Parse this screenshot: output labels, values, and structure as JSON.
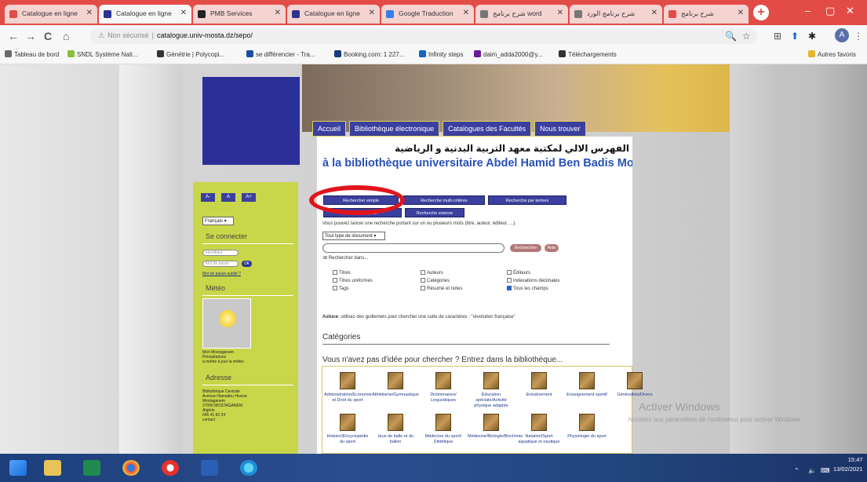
{
  "browser": {
    "tabs": [
      {
        "label": "Catalogue en ligne",
        "color": "#e34b47",
        "active": false
      },
      {
        "label": "Catalogue en ligne",
        "color": "#2d3190",
        "active": true
      },
      {
        "label": "PMB Services",
        "color": "#222222",
        "active": false
      },
      {
        "label": "Catalogue en ligne",
        "color": "#2d3190",
        "active": false
      },
      {
        "label": "Google Traduction",
        "color": "#3a7ee8",
        "active": false
      },
      {
        "label": "شرح برنامج word",
        "color": "#777777",
        "active": false
      },
      {
        "label": "شرح برنامج الورد",
        "color": "#777777",
        "active": false
      },
      {
        "label": "شرح برنامج",
        "color": "#e34b47",
        "active": false
      }
    ],
    "new_tab": "+",
    "win_controls": [
      "–",
      "▢",
      "✕"
    ],
    "nav": {
      "back": "←",
      "forward": "→",
      "reload": "C",
      "home": "⌂"
    },
    "address": {
      "security": "Non sécurisé",
      "url": "catalogue.univ-mosta.dz/sepo/"
    },
    "right_icons": [
      "🔍",
      "☆",
      "⊞",
      "⬆",
      "✱"
    ],
    "avatar": "A",
    "bookmarks": [
      {
        "label": "Tableau de bord",
        "color": "#6b6b6b"
      },
      {
        "label": "SNDL Système Nati...",
        "color": "#8bbf3a"
      },
      {
        "label": "Génétrie | Polycopi...",
        "color": "#333333"
      },
      {
        "label": "se différencier - Tra...",
        "color": "#1a4fa0"
      },
      {
        "label": "Booking.com: 1 227...",
        "color": "#1a3a80"
      },
      {
        "label": "Infinity steps",
        "color": "#1565c0"
      },
      {
        "label": "daim_adda2000@y...",
        "color": "#6a1b9a"
      },
      {
        "label": "Téléchargements",
        "color": "#333333"
      }
    ],
    "other_bookmarks": "Autres favoris"
  },
  "site": {
    "nav_items": [
      "Accueil",
      "Bibliothèque électronique",
      "Catalogues des Facultés",
      "Nous trouver"
    ],
    "title_ar": "الفهرس الالي لمكتبة معهد التربية البدنية و الرياضية",
    "title_fr": "à la bibliothèque universitaire Abdel Hamid Ben Badis Mostaganem",
    "search_tabs": [
      "Rechercher simple",
      "Recherche multi-critères",
      "Recherche par termes",
      "Derniers ajouts",
      "Recherche externe"
    ],
    "hint": "Vous pouvez lancer une recherche portant sur un ou plusieurs mots (titre, auteur, éditeur, ...).",
    "doc_type": "Tout type de document",
    "btn_search": "Rechercher",
    "btn_help": "Aide",
    "search_in": "Rechercher dans...",
    "checkboxes": [
      {
        "label": "Titres",
        "checked": false
      },
      {
        "label": "Auteurs",
        "checked": false
      },
      {
        "label": "Éditeurs",
        "checked": false
      },
      {
        "label": "Titres uniformes",
        "checked": false
      },
      {
        "label": "Catégories",
        "checked": false
      },
      {
        "label": "Indexations décimales",
        "checked": false
      },
      {
        "label": "Tags",
        "checked": false
      },
      {
        "label": "Résumé et notes",
        "checked": false
      },
      {
        "label": "Tous les champs",
        "checked": true
      }
    ],
    "astuce_label": "Astuce",
    "astuce_text": ": utilisez des guillemets pour chercher une suite de caractères : \"révolution française\"",
    "categories_heading": "Catégories",
    "categories_intro": "Vous n'avez pas d'idée pour chercher ? Entrez dans la bibliothèque...",
    "categories": [
      "Administration/Economie et Droit du sport",
      "Athlétisme/Gymnastique",
      "Dictionnaires/ Linguistiques",
      "Éducation spéciale/Activité physique adaptée",
      "Entraînement",
      "Enseignement sportif",
      "Généralités/Divers",
      "Histoire/Encyclopédie du sport",
      "Jeux de balle et du ballon",
      "Médecine du sport/ Diététique",
      "Médecine/Biologie/Biochimie",
      "Natation/Sport aquatique et nautique",
      "Physiologie du sport"
    ]
  },
  "sidebar": {
    "font_buttons": [
      "A-",
      "A",
      "A+"
    ],
    "language": "Français",
    "login_heading": "Se connecter",
    "login_placeholder": "identifiant",
    "password_placeholder": "Mot de passe",
    "ok": "OK",
    "forgot": "Mot de passe oublié ?",
    "meteo_heading": "Météo",
    "meteo_lines": [
      "Mon Mostaganem",
      "Précipitations",
      "à mettre à jour la météo"
    ],
    "address_heading": "Adresse",
    "address_lines": [
      "Bibliothèque Centrale",
      "Avenue Hamadou Hocine",
      "Mostaganem",
      "27000 MOSTAGANEM",
      "Algérie",
      "045 41 82 24",
      "contact"
    ]
  },
  "windows": {
    "activate_title": "Activer Windows",
    "activate_sub": "Accédez aux paramètres de l'ordinateur pour activer Windows.",
    "time": "15:47",
    "date": "13/02/2021"
  }
}
